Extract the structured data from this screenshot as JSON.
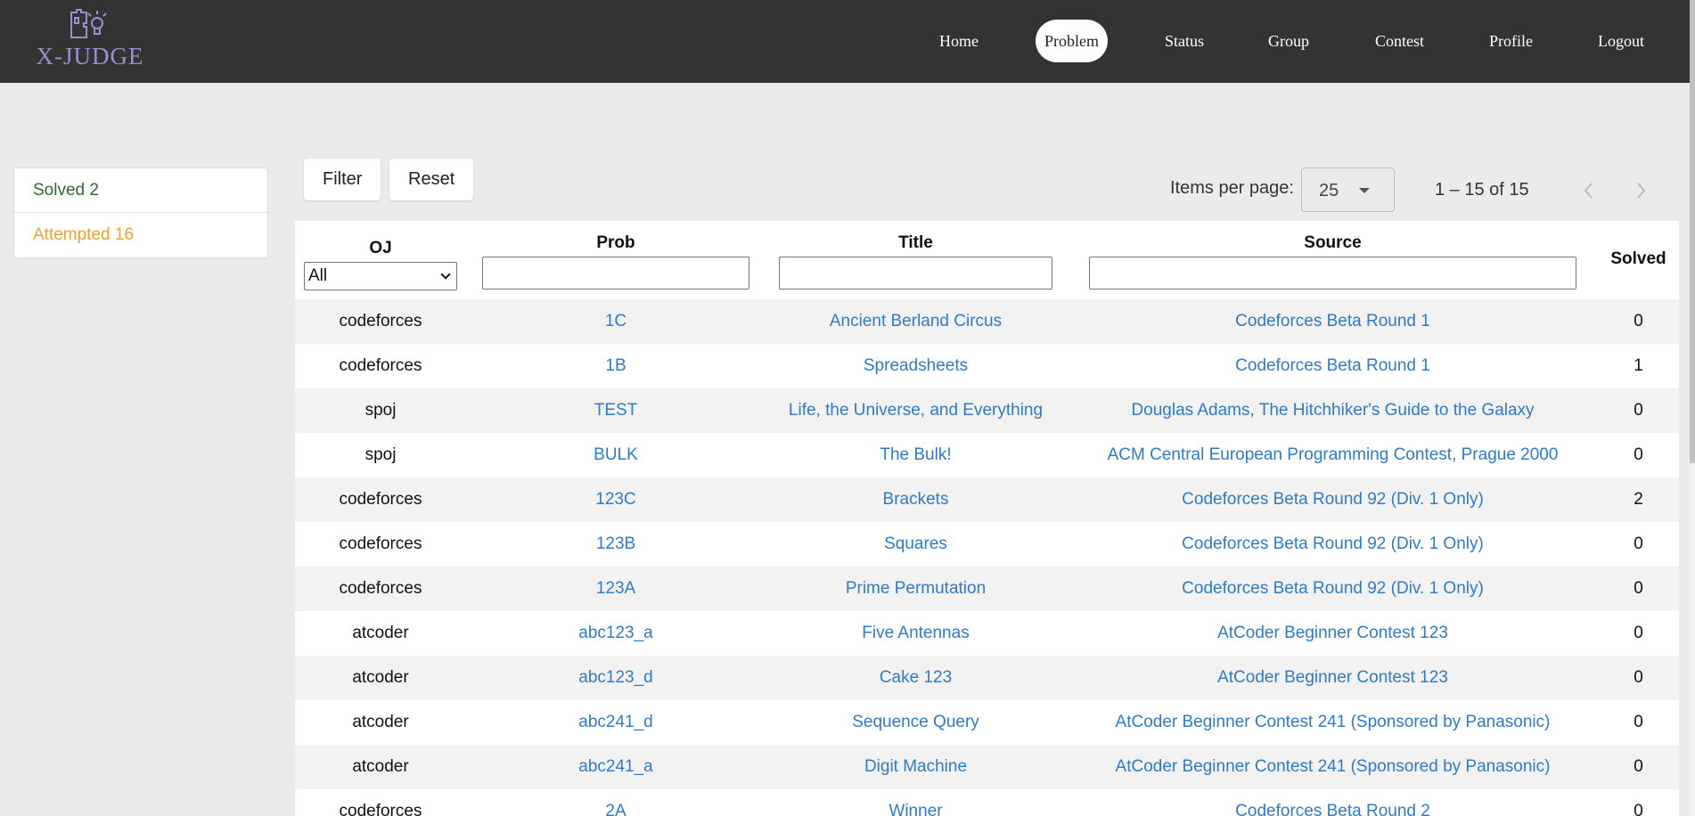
{
  "brand": {
    "name": "X-JUDGE"
  },
  "nav": [
    {
      "label": "Home",
      "active": false
    },
    {
      "label": "Problem",
      "active": true
    },
    {
      "label": "Status",
      "active": false
    },
    {
      "label": "Group",
      "active": false
    },
    {
      "label": "Contest",
      "active": false
    },
    {
      "label": "Profile",
      "active": false
    },
    {
      "label": "Logout",
      "active": false
    }
  ],
  "sidebar": {
    "solved": "Solved 2",
    "attempted": "Attempted 16"
  },
  "toolbar": {
    "filter_label": "Filter",
    "reset_label": "Reset"
  },
  "pager": {
    "items_label": "Items per page:",
    "items_value": "25",
    "range": "1 – 15 of 15"
  },
  "table": {
    "headers": {
      "oj": "OJ",
      "prob": "Prob",
      "title": "Title",
      "source": "Source",
      "solved": "Solved"
    },
    "oj_filter_value": "All",
    "rows": [
      {
        "oj": "codeforces",
        "prob": "1C",
        "title": "Ancient Berland Circus",
        "source": "Codeforces Beta Round 1",
        "solved": "0"
      },
      {
        "oj": "codeforces",
        "prob": "1B",
        "title": "Spreadsheets",
        "source": "Codeforces Beta Round 1",
        "solved": "1"
      },
      {
        "oj": "spoj",
        "prob": "TEST",
        "title": "Life, the Universe, and Everything",
        "source": "Douglas Adams, The Hitchhiker's Guide to the Galaxy",
        "solved": "0"
      },
      {
        "oj": "spoj",
        "prob": "BULK",
        "title": "The Bulk!",
        "source": "ACM Central European Programming Contest, Prague 2000",
        "solved": "0"
      },
      {
        "oj": "codeforces",
        "prob": "123C",
        "title": "Brackets",
        "source": "Codeforces Beta Round 92 (Div. 1 Only)",
        "solved": "2"
      },
      {
        "oj": "codeforces",
        "prob": "123B",
        "title": "Squares",
        "source": "Codeforces Beta Round 92 (Div. 1 Only)",
        "solved": "0"
      },
      {
        "oj": "codeforces",
        "prob": "123A",
        "title": "Prime Permutation",
        "source": "Codeforces Beta Round 92 (Div. 1 Only)",
        "solved": "0"
      },
      {
        "oj": "atcoder",
        "prob": "abc123_a",
        "title": "Five Antennas",
        "source": "AtCoder Beginner Contest 123",
        "solved": "0"
      },
      {
        "oj": "atcoder",
        "prob": "abc123_d",
        "title": "Cake 123",
        "source": "AtCoder Beginner Contest 123",
        "solved": "0"
      },
      {
        "oj": "atcoder",
        "prob": "abc241_d",
        "title": "Sequence Query",
        "source": "AtCoder Beginner Contest 241  (Sponsored by Panasonic)",
        "solved": "0"
      },
      {
        "oj": "atcoder",
        "prob": "abc241_a",
        "title": "Digit Machine",
        "source": "AtCoder Beginner Contest 241  (Sponsored by Panasonic)",
        "solved": "0"
      },
      {
        "oj": "codeforces",
        "prob": "2A",
        "title": "Winner",
        "source": "Codeforces Beta Round 2",
        "solved": "0"
      }
    ]
  },
  "colors": {
    "navbar": "#333333",
    "link": "#2d7bc4",
    "solved": "#2e6b2e",
    "attempted": "#f0a030",
    "logo": "#9b8fcf"
  },
  "icons": {
    "logo": "puzzle-lightbulb-icon",
    "prev": "chevron-left-icon",
    "next": "chevron-right-icon"
  }
}
